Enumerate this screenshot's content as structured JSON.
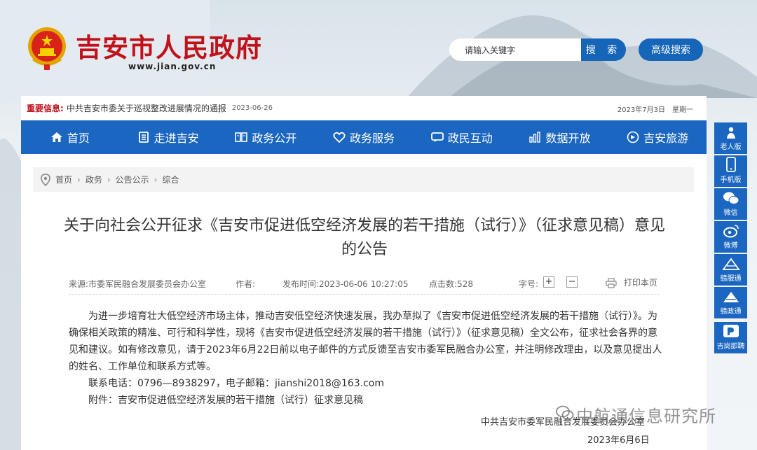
{
  "header": {
    "site_title": "吉安市人民政府",
    "site_url": "www.jian.gov.cn",
    "search_placeholder": "请输入关键字",
    "search_button": "搜 索",
    "advanced_search": "高级搜索"
  },
  "notice": {
    "label": "重要信息:",
    "text": "中共吉安市委关于巡视整改进展情况的通报",
    "date": "2023-06-26",
    "today": "2023年7月3日　星期一"
  },
  "nav": [
    {
      "label": "首页",
      "icon": "home-icon"
    },
    {
      "label": "走进吉安",
      "icon": "book-icon"
    },
    {
      "label": "政务公开",
      "icon": "document-icon"
    },
    {
      "label": "政务服务",
      "icon": "heart-icon"
    },
    {
      "label": "政民互动",
      "icon": "chat-icon"
    },
    {
      "label": "数据开放",
      "icon": "bar-chart-icon"
    },
    {
      "label": "吉安旅游",
      "icon": "travel-icon"
    }
  ],
  "breadcrumb": [
    "首页",
    "政务",
    "公告公示",
    "综合"
  ],
  "article": {
    "title": "关于向社会公开征求《吉安市促进低空经济发展的若干措施（试行）》（征求意见稿）意见的公告",
    "source": "来源:市委军民融合发展委员会办公室",
    "author": "作者:",
    "publish_time": "发布时间:2023-06-06 10:27:05",
    "clicks": "点击数:528",
    "font_size_label": "字号:",
    "font_plus": "+",
    "font_minus": "−",
    "print": "打印本页",
    "paragraph": "为进一步培育壮大低空经济市场主体，推动吉安低空经济快速发展，我办草拟了《吉安市促进低空经济发展的若干措施（试行）》。为确保相关政策的精准、可行和科学性，现将《吉安市促进低空经济发展的若干措施（试行）》（征求意见稿）全文公布，征求社会各界的意见和建议。如有修改意见，请于2023年6月22日前以电子邮件的方式反馈至吉安市委军民融合办公室，并注明修改理由，以及意见提出人的姓名、工作单位和联系方式等。",
    "contact": "联系电话：0796—8938297，电子邮箱：jianshi2018@163.com",
    "attachment": "附件：吉安市促进低空经济发展的若干措施（试行）征求意见稿",
    "signer": "中共吉安市委军民融合发展委员会办公室",
    "sign_date": "2023年6月6日"
  },
  "watermark": "中航通信息研究所",
  "sidebar": [
    {
      "label": "老人版",
      "icon": "elder-icon"
    },
    {
      "label": "手机版",
      "icon": "phone-icon"
    },
    {
      "label": "微信",
      "icon": "wechat-icon"
    },
    {
      "label": "微博",
      "icon": "weibo-icon"
    },
    {
      "label": "赣服通",
      "icon": "ganfutong-icon"
    },
    {
      "label": "赣政通",
      "icon": "ganzhengtong-icon"
    },
    {
      "label": "吉岗即聘",
      "icon": "jobs-icon"
    }
  ],
  "colors": {
    "brand_red": "#c1121b",
    "nav_blue": "#1b66c0",
    "button_blue": "#1565b8"
  }
}
